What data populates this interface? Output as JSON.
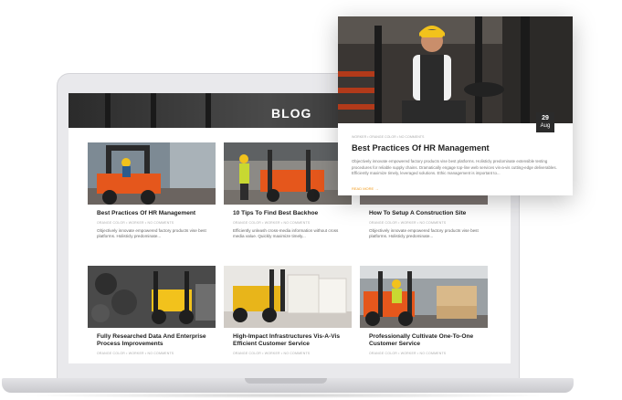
{
  "banner": {
    "title": "BLOG"
  },
  "cards": [
    {
      "title": "Best Practices Of HR Management",
      "meta": "ORANGE COLOR  •  WORKER  •  NO COMMENTS",
      "excerpt": "Objectively innovate empowered factory products vise best platforms. Holisticly predominate..."
    },
    {
      "title": "10 Tips To Find Best Backhoe",
      "meta": "ORANGE COLOR  •  WORKER  •  NO COMMENTS",
      "excerpt": "Efficiently unleash cross-media information without cross media value. Quickly maximize timely..."
    },
    {
      "title": "How To Setup A Construction Site",
      "meta": "ORANGE COLOR  •  WORKER  •  NO COMMENTS",
      "excerpt": "Objectively innovate empowered factory products vise best platforms. Holisticly predominate..."
    },
    {
      "title": "Fully Researched Data And Enterprise Process Improvements",
      "meta": "ORANGE COLOR  •  WORKER  •  NO COMMENTS",
      "excerpt": ""
    },
    {
      "title": "High-Impact Infrastructures Vis-A-Vis Efficient Customer Service",
      "meta": "ORANGE COLOR  •  WORKER  •  NO COMMENTS",
      "excerpt": ""
    },
    {
      "title": "Professionally Cultivate One-To-One Customer Service",
      "meta": "ORANGE COLOR  •  WORKER  •  NO COMMENTS",
      "excerpt": ""
    }
  ],
  "featured": {
    "date_day": "29",
    "date_month": "Aug",
    "meta": "WORKER  •  ORANGE COLOR  •  NO COMMENTS",
    "title": "Best Practices Of HR Management",
    "excerpt": "Objectively innovate empowered factory products vise best platforms. Holisticly predominate extensible testing procedures for reliable supply chains. Dramatically engage top-line web services vis-a-vis cutting-edge deliverables. Efficiently maximize timely, leveraged solutions. Ethic management is important to...",
    "read_more": "READ MORE  →"
  },
  "colors": {
    "accent": "#f29b1c",
    "forklift": "#e5571c",
    "forklift_yellow": "#f2c21c"
  }
}
